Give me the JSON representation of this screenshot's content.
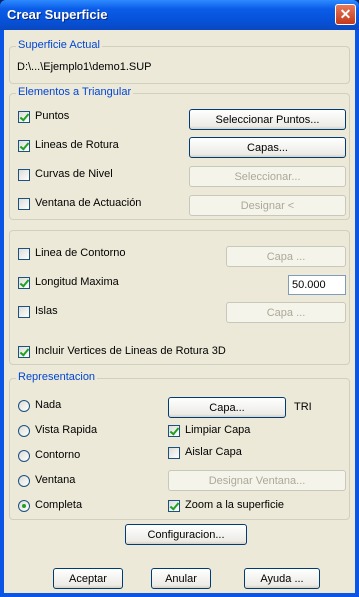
{
  "window": {
    "title": "Crear Superficie",
    "close_glyph": "✕"
  },
  "superficie": {
    "legend": "Superficie Actual",
    "path": "D:\\...\\Ejemplo1\\demo1.SUP"
  },
  "elementos": {
    "legend": "Elementos a Triangular",
    "puntos": {
      "label": "Puntos",
      "checked": true,
      "button": "Seleccionar Puntos..."
    },
    "lineas": {
      "label": "Lineas de Rotura",
      "checked": true,
      "button": "Capas..."
    },
    "curvas": {
      "label": "Curvas de Nivel",
      "checked": false,
      "button": "Seleccionar..."
    },
    "ventana": {
      "label": "Ventana de Actuación",
      "checked": false,
      "button": "Designar <"
    }
  },
  "contorno": {
    "linea": {
      "label": "Linea de Contorno",
      "checked": false,
      "button": "Capa ..."
    },
    "longitud": {
      "label": "Longitud Maxima",
      "checked": true,
      "value": "50.000"
    },
    "islas": {
      "label": "Islas",
      "checked": false,
      "button": "Capa ..."
    },
    "incluir": {
      "label": "Incluir Vertices de Lineas de Rotura 3D",
      "checked": true
    }
  },
  "representacion": {
    "legend": "Representacion",
    "nada": "Nada",
    "vista": "Vista Rapida",
    "contorno": "Contorno",
    "ventana": "Ventana",
    "completa": "Completa",
    "selected": "completa",
    "capa_button": "Capa...",
    "capa_value": "TRI",
    "limpiar": {
      "label": "Limpiar Capa",
      "checked": true
    },
    "aislar": {
      "label": "Aislar Capa",
      "checked": false
    },
    "designar_button": "Designar Ventana...",
    "zoom": {
      "label": "Zoom a la superficie",
      "checked": true
    }
  },
  "buttons": {
    "config": "Configuracion...",
    "aceptar": "Aceptar",
    "anular": "Anular",
    "ayuda": "Ayuda ..."
  }
}
